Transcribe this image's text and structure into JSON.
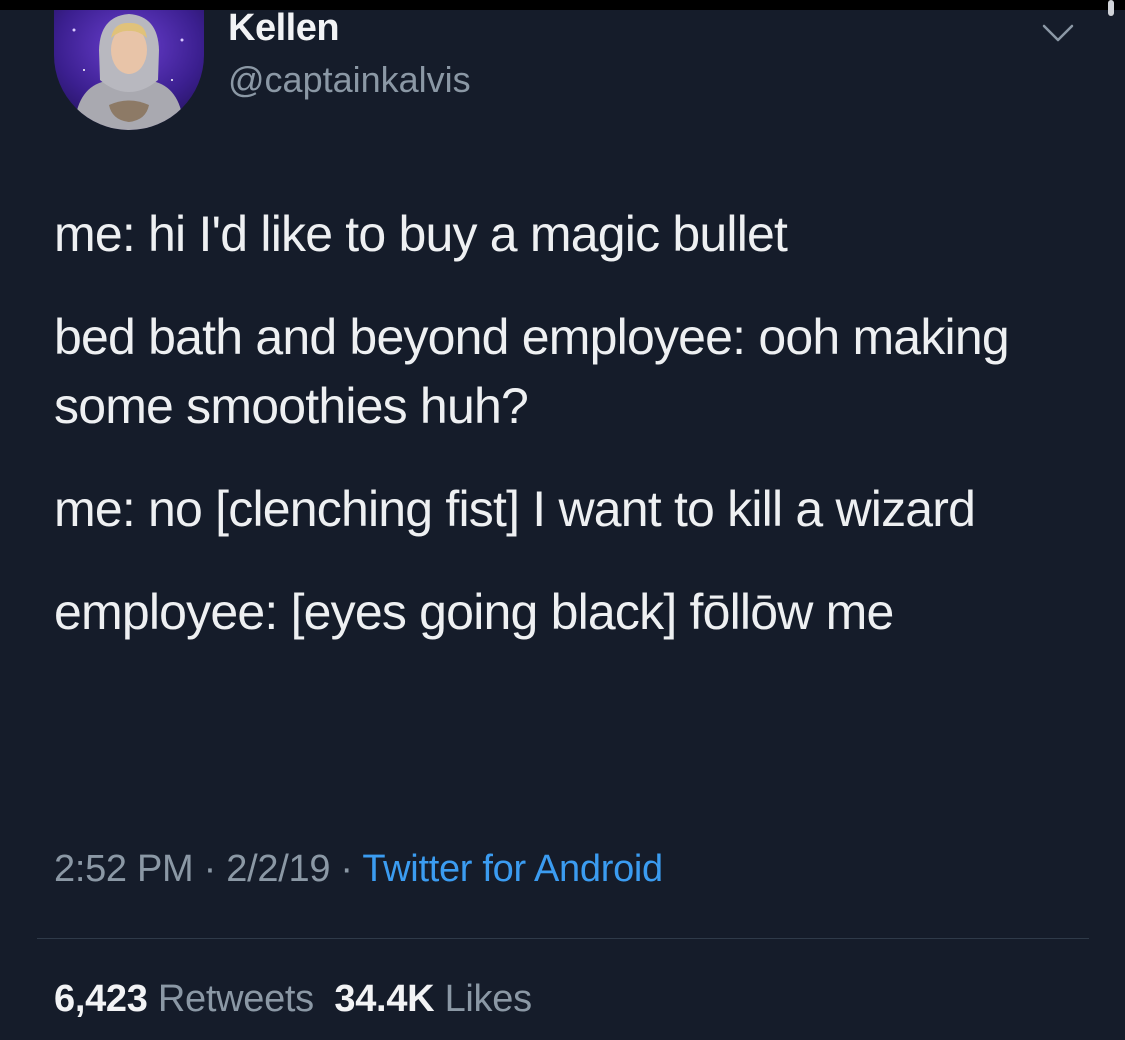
{
  "user": {
    "display_name": "Kellen",
    "handle": "@captainkalvis",
    "avatar_icon": "profile-photo"
  },
  "header": {
    "menu_icon": "chevron-down-icon"
  },
  "tweet": {
    "paragraphs": [
      "me: hi I'd like to buy a magic bullet",
      "bed bath and beyond employee: ooh making some smoothies huh?",
      "me: no [clenching fist] I want to kill a wizard",
      "employee: [eyes going black] fōllōw me"
    ]
  },
  "meta": {
    "time": "2:52 PM",
    "separator": " · ",
    "date": "2/2/19",
    "source": "Twitter for Android"
  },
  "stats": {
    "retweets_count": "6,423",
    "retweets_label": "Retweets",
    "likes_count": "34.4K",
    "likes_label": "Likes"
  },
  "colors": {
    "background": "#151c2a",
    "text": "#eef0f2",
    "secondary_text": "#8b98a5",
    "link": "#3b9cf1"
  }
}
